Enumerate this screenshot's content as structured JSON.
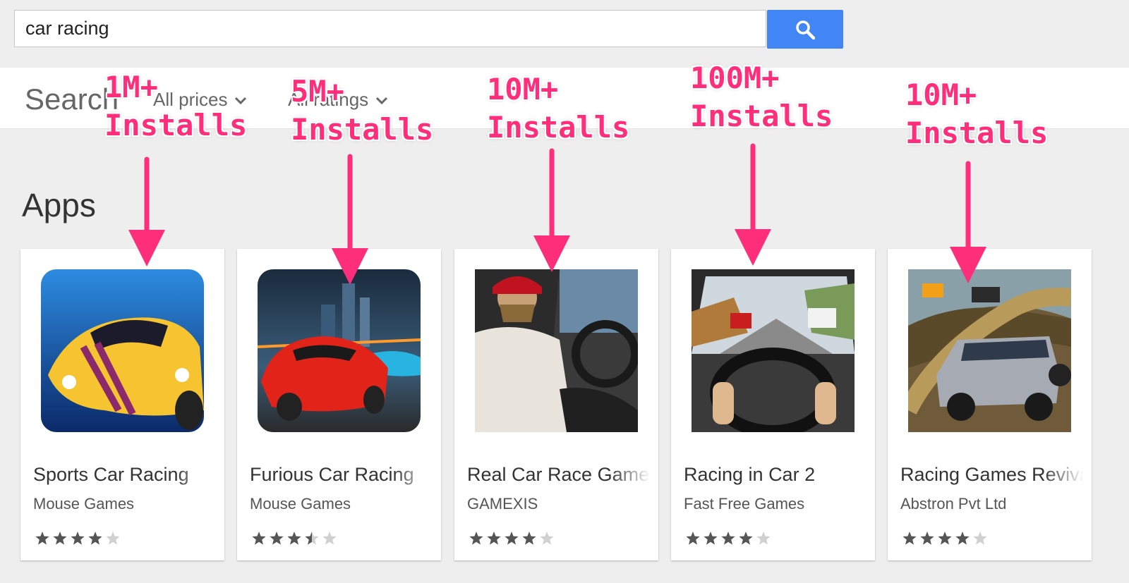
{
  "search": {
    "query": "car racing"
  },
  "filter_bar": {
    "title": "Search",
    "filters": [
      {
        "label": "All prices"
      },
      {
        "label": "All ratings"
      }
    ]
  },
  "section": {
    "title": "Apps"
  },
  "apps": [
    {
      "title": "Sports Car Racing",
      "developer": "Mouse Games",
      "rating": 4,
      "installs": "1M+\nInstalls"
    },
    {
      "title": "Furious Car Racing",
      "developer": "Mouse Games",
      "rating": 3.5,
      "installs": "5M+\nInstalls"
    },
    {
      "title": "Real Car Race Game",
      "developer": "GAMEXIS",
      "rating": 4,
      "installs": "10M+\nInstalls"
    },
    {
      "title": "Racing in Car 2",
      "developer": "Fast Free Games",
      "rating": 4,
      "installs": "100M+\nInstalls"
    },
    {
      "title": "Racing Games Revival",
      "developer": "Abstron Pvt Ltd",
      "rating": 4,
      "installs": "10M+\nInstalls"
    }
  ],
  "colors": {
    "accent": "#4285f4",
    "annotation": "#ff2e7a",
    "star_filled": "#555555",
    "star_empty": "#d0d0d0"
  }
}
